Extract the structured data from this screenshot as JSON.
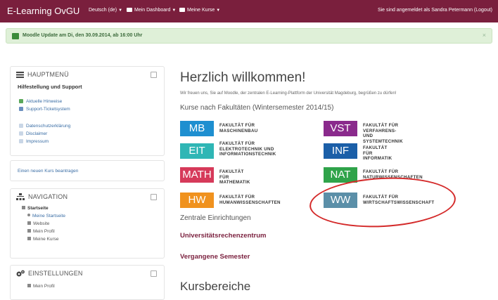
{
  "topbar": {
    "brand": "E-Learning OvGU",
    "language": "Deutsch (de)",
    "dashboard": "Mein Dashboard",
    "courses": "Meine Kurse",
    "login_status": "Sie sind angemeldet als Sandra Petermann (Logout)"
  },
  "notice": {
    "text": "Moodle Update am Di, den 30.09.2014, ab 16:00 Uhr",
    "close": "×"
  },
  "mainmenu": {
    "title": "HAUPTMENÜ",
    "subtitle": "Hilfestellung und Support",
    "links1": [
      "Aktuelle Hinweise",
      "Support-Ticketsystem"
    ],
    "links2": [
      "Datenschutzerklärung",
      "Disclaimer",
      "Impressum"
    ]
  },
  "request_block": {
    "link": "Einen neuen Kurs beantragen"
  },
  "navigation": {
    "title": "NAVIGATION",
    "items": [
      "Startseite",
      "Meine Startseite",
      "Website",
      "Mein Profil",
      "Meine Kurse"
    ]
  },
  "settings": {
    "title": "EINSTELLUNGEN",
    "items": [
      "Mein Profil"
    ]
  },
  "main": {
    "welcome": "Herzlich willkommen!",
    "intro": "Wir freuen uns, Sie auf Moodle, der zentralen E-Learning-Plattform der Universität Magdeburg, begrüßen zu dürfen!",
    "faculties_heading": "Kurse nach Fakultäten (Wintersemester 2014/15)",
    "faculties": [
      {
        "abbr": "MB",
        "name": "FAKULTÄT FÜR\nMASCHINENBAU",
        "color": "#1e8fd0"
      },
      {
        "abbr": "VST",
        "name": "FAKULTÄT FÜR VERFAHRENS-\nUND SYSTEMTECHNIK",
        "color": "#8a2a8c"
      },
      {
        "abbr": "EIT",
        "name": "FAKULTÄT FÜR\nELEKTROTECHNIK UND\nINFORMATIONSTECHNIK",
        "color": "#2fb6b5"
      },
      {
        "abbr": "INF",
        "name": "FAKULTÄT FÜR\nINFORMATIK",
        "color": "#1b5fa8"
      },
      {
        "abbr": "MATH",
        "name": "FAKULTÄT FÜR\nMATHEMATIK",
        "color": "#d63a5a"
      },
      {
        "abbr": "NAT",
        "name": "FAKULTÄT FÜR\nNATURWISSENSCHAFTEN",
        "color": "#2fa34a"
      },
      {
        "abbr": "HW",
        "name": "FAKULTÄT FÜR\nHUMANWISSENSCHAFTEN",
        "color": "#f0921e"
      },
      {
        "abbr": "WW",
        "name": "FAKULTÄT FÜR\nWIRTSCHAFTSWISSENSCHAFT",
        "color": "#5b8fa8"
      }
    ],
    "central_heading": "Zentrale Einrichtungen",
    "central_link": "Universitätsrechenzentrum",
    "past_semester": "Vergangene Semester",
    "course_areas": "Kursbereiche"
  }
}
